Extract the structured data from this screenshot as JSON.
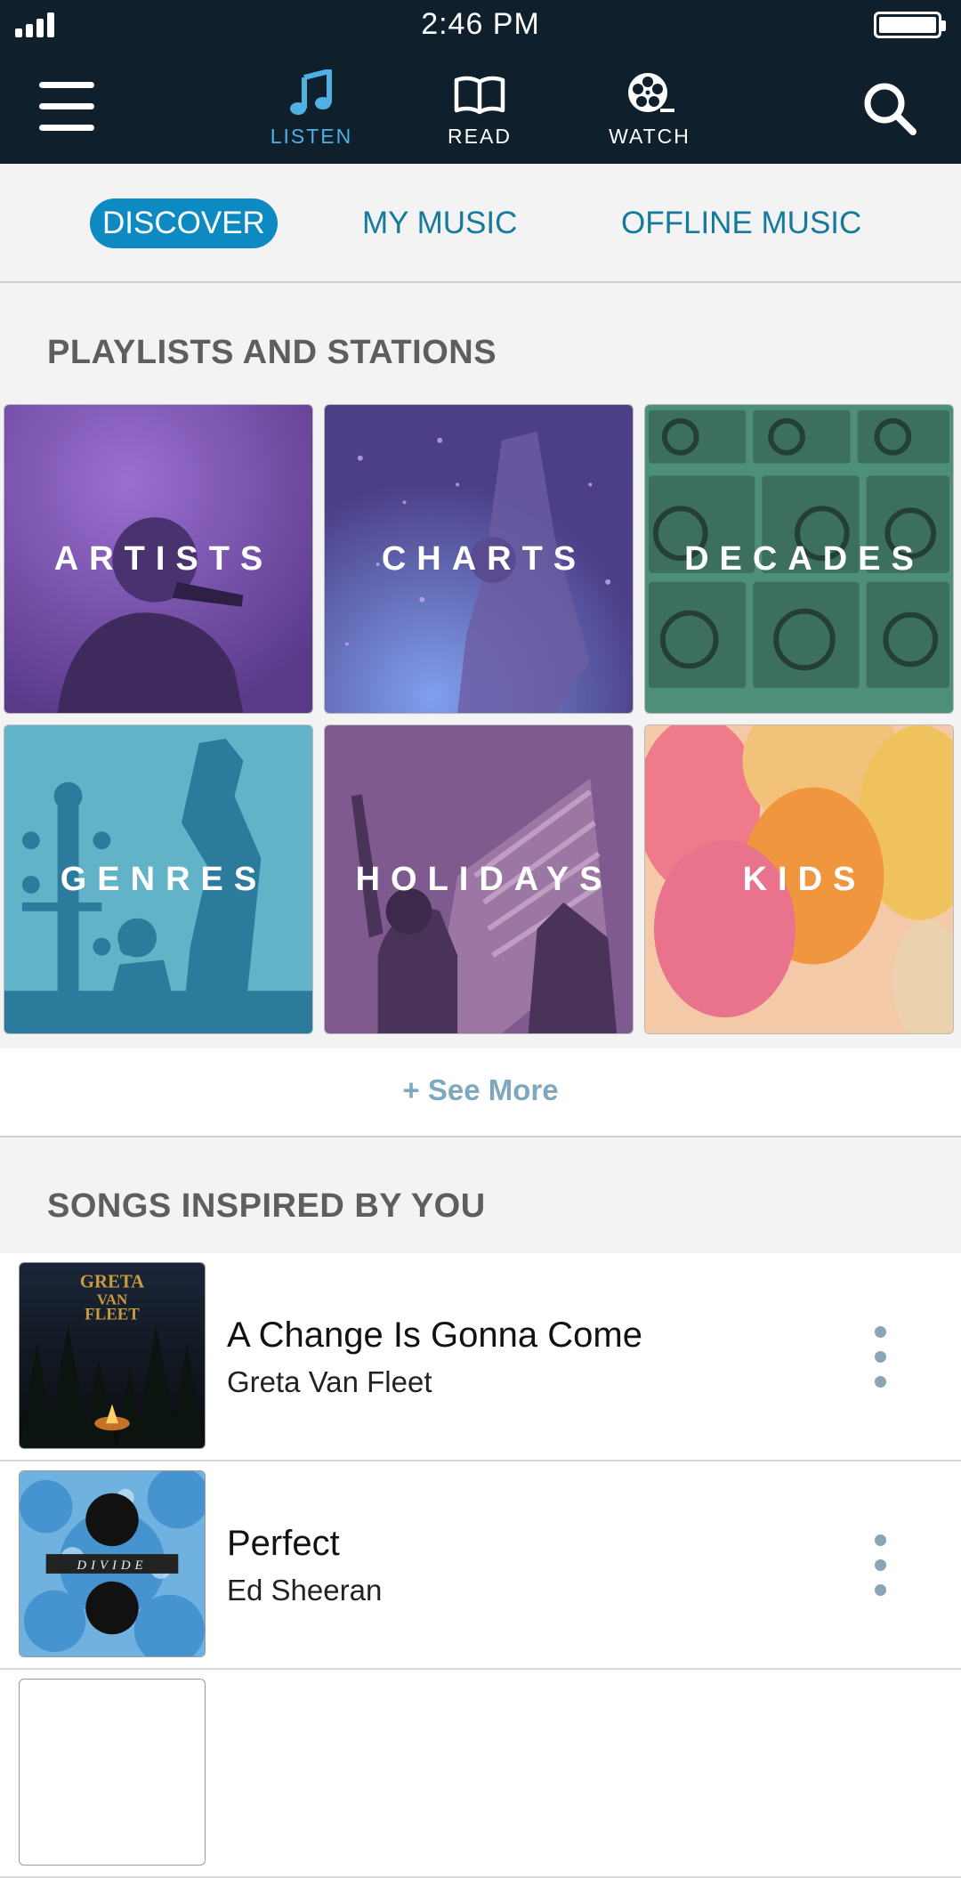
{
  "status": {
    "time": "2:46 PM"
  },
  "modes": [
    {
      "label": "LISTEN",
      "icon": "music-note-icon",
      "active": true
    },
    {
      "label": "READ",
      "icon": "book-icon",
      "active": false
    },
    {
      "label": "WATCH",
      "icon": "film-reel-icon",
      "active": false
    }
  ],
  "tabs": [
    {
      "label": "DISCOVER",
      "active": true
    },
    {
      "label": "MY MUSIC",
      "active": false
    },
    {
      "label": "OFFLINE MUSIC",
      "active": false
    }
  ],
  "playlists": {
    "title": "PLAYLISTS AND STATIONS",
    "tiles": [
      {
        "label": "ARTISTS"
      },
      {
        "label": "CHARTS"
      },
      {
        "label": "DECADES"
      },
      {
        "label": "GENRES"
      },
      {
        "label": "HOLIDAYS"
      },
      {
        "label": "KIDS"
      }
    ],
    "see_more": "+ See More"
  },
  "songs": {
    "title": "SONGS INSPIRED BY YOU",
    "items": [
      {
        "title": "A Change Is Gonna Come",
        "artist": "Greta Van Fleet",
        "album_art_text": "GRETA VAN FLEET"
      },
      {
        "title": "Perfect",
        "artist": "Ed Sheeran",
        "album_art_text": "DIVIDE"
      }
    ]
  },
  "colors": {
    "header_bg": "#0f1f2c",
    "accent": "#0e8ac2",
    "active_mode": "#4fb1e2",
    "tab_text": "#157a9c"
  }
}
